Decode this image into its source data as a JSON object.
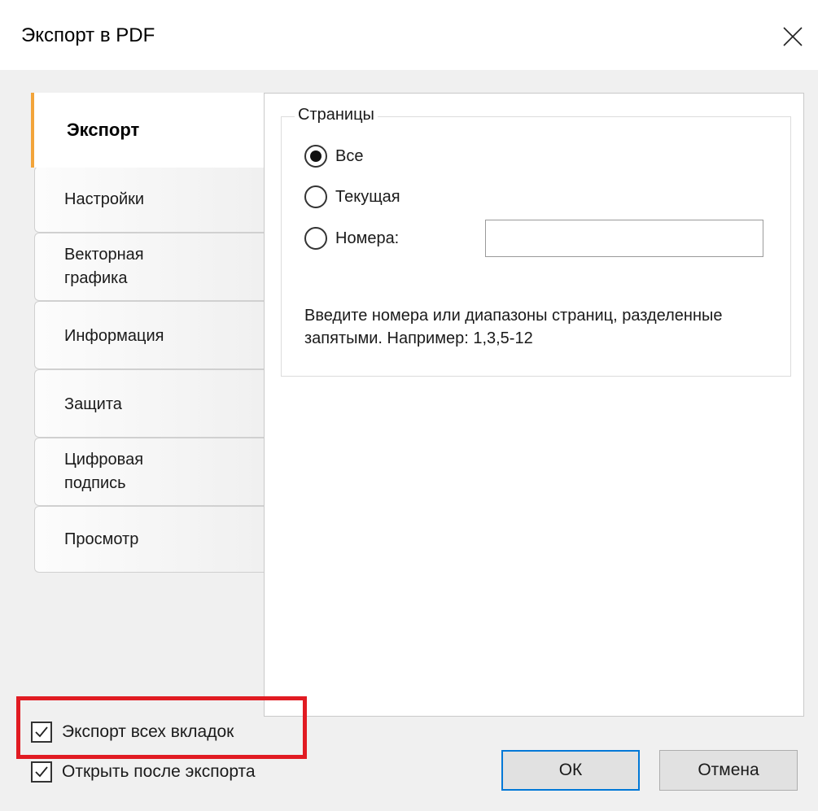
{
  "window": {
    "title": "Экспорт в PDF"
  },
  "tabs": [
    {
      "label": "Экспорт",
      "active": true
    },
    {
      "label": "Настройки"
    },
    {
      "label": "Векторная графика"
    },
    {
      "label": "Информация"
    },
    {
      "label": "Защита"
    },
    {
      "label": "Цифровая подпись"
    },
    {
      "label": "Просмотр"
    }
  ],
  "pages_group": {
    "title": "Страницы",
    "options": [
      {
        "label": "Все",
        "selected": true
      },
      {
        "label": "Текущая",
        "selected": false
      },
      {
        "label": "Номера:",
        "selected": false
      }
    ],
    "numbers_value": "",
    "hint": "Введите номера или диапазоны страниц, разделенные запятыми. Например: 1,3,5-12"
  },
  "checkboxes": {
    "export_all_tabs": {
      "label": "Экспорт всех вкладок",
      "checked": true
    },
    "open_after_export": {
      "label": "Открыть после экспорта",
      "checked": true
    }
  },
  "buttons": {
    "ok": "ОК",
    "cancel": "Отмена"
  },
  "colors": {
    "active_tab_accent": "#f2a43a",
    "highlight": "#e11b22",
    "ok_border": "#0078d7"
  }
}
